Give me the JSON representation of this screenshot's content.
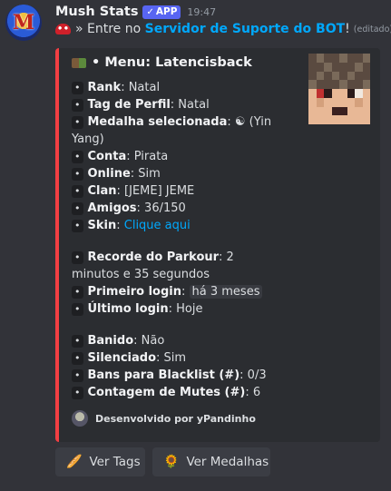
{
  "message": {
    "username": "Mush Stats",
    "app_badge": "APP",
    "app_badge_check": "✓",
    "timestamp": "19:47",
    "content_prefix": "» Entre no",
    "content_link": "Servidor de Suporte do BOT",
    "content_suffix": "!",
    "edited": "(editado)"
  },
  "embed": {
    "title": "• Menu: Latencisback",
    "accent_color": "#f23f43",
    "fields": [
      {
        "label": "Rank",
        "value": ": Natal"
      },
      {
        "label": "Tag de Perfil",
        "value": ": Natal"
      },
      {
        "label": "Medalha selecionada",
        "value": ": ☯ (Yin Yang)"
      },
      {
        "label": "Conta",
        "value": ": Pirata"
      },
      {
        "label": "Online",
        "value": ": Sim"
      },
      {
        "label": "Clan",
        "value": ": [JEME] JEME"
      },
      {
        "label": "Amigos",
        "value": ": 36/150"
      },
      {
        "label": "Skin",
        "value": ": ",
        "link": "Clique aqui"
      },
      {
        "label": "Recorde do Parkour",
        "value": ": 2 minutos e 35 segundos"
      },
      {
        "label": "Primeiro login",
        "value": ": ",
        "code": "há 3 meses"
      },
      {
        "label": "Último login",
        "value": ": Hoje"
      },
      {
        "label": "Banido",
        "value": ": Não"
      },
      {
        "label": "Silenciado",
        "value": ": Sim"
      },
      {
        "label": "Bans para Blacklist (#)",
        "value": ": 0/3"
      },
      {
        "label": "Contagem de Mutes (#)",
        "value": ": 6"
      }
    ],
    "bullet": "•",
    "footer": "Desenvolvido por yPandinho"
  },
  "buttons": {
    "tags": {
      "label": "Ver Tags",
      "icon": "tag-icon"
    },
    "medals": {
      "label": "Ver Medalhas",
      "icon": "sunflower-icon"
    }
  }
}
